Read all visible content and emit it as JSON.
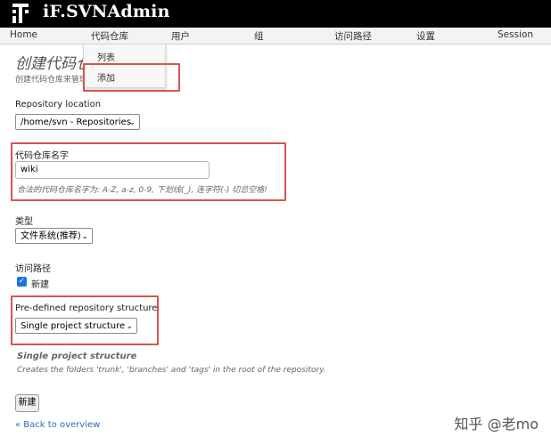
{
  "app": {
    "title": "iF.SVNAdmin"
  },
  "nav": {
    "items": [
      {
        "label": "Home"
      },
      {
        "label": "代码仓库"
      },
      {
        "label": "用户"
      },
      {
        "label": "组"
      },
      {
        "label": "访问路径"
      },
      {
        "label": "设置"
      },
      {
        "label": "Session"
      }
    ]
  },
  "dropdown": {
    "items": [
      {
        "label": "列表"
      },
      {
        "label": "添加"
      }
    ]
  },
  "page": {
    "title": "创建代码仓",
    "subtitle": "创建代码仓库来管理"
  },
  "form": {
    "location": {
      "label": "Repository location",
      "value": "/home/svn - Repositories"
    },
    "name": {
      "label": "代码仓库名字",
      "value": "wiki",
      "hint": "合法的代码仓库名字为: A-Z, a-z, 0-9, 下划线(_), 连字符(-) 切忌空格!"
    },
    "type": {
      "label": "类型",
      "value": "文件系统(推荐)"
    },
    "access": {
      "label": "访问路径",
      "checkbox_label": "新建",
      "checked": true
    },
    "structure": {
      "label": "Pre-defined repository structure",
      "value": "Single project structure",
      "desc_title": "Single project structure",
      "desc": "Creates the folders 'trunk', 'branches' and 'tags' in the root of the repository."
    },
    "submit_label": "新建",
    "back_link": "« Back to overview"
  },
  "watermark": "知乎 @老mo",
  "colors": {
    "highlight": "#d9534f",
    "header": "#000000",
    "link": "#2a6ebb",
    "checkbox": "#1a73e8"
  }
}
